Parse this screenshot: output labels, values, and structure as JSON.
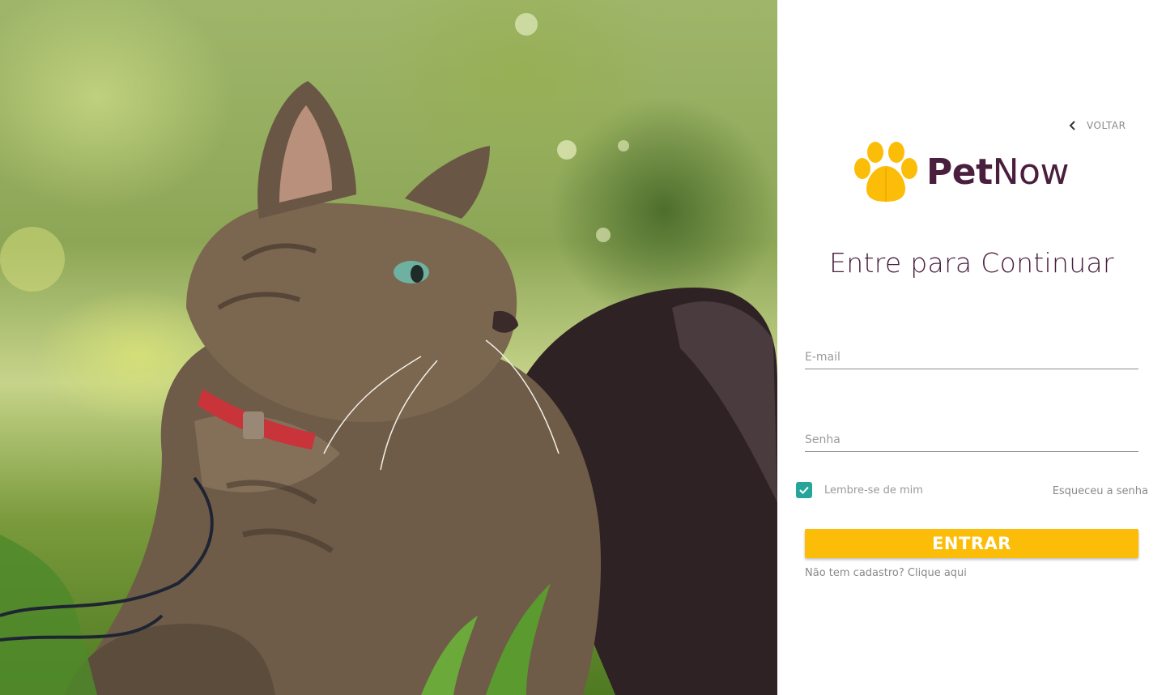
{
  "nav": {
    "back_label": "VOLTAR"
  },
  "brand": {
    "name_bold": "Pet",
    "name_regular": "Now",
    "accent_color": "#fbbd08",
    "text_color": "#4a1f3e"
  },
  "login": {
    "heading": "Entre para Continuar",
    "email_placeholder": "E-mail",
    "password_placeholder": "Senha",
    "remember_label": "Lembre-se de mim",
    "remember_checked": true,
    "forgot_label": "Esqueceu a senha",
    "submit_label": "ENTRAR",
    "signup_label": "Não tem cadastro? Clique aqui"
  },
  "icons": {
    "back": "chevron-left-icon",
    "logo": "paw-icon",
    "checkbox": "check-icon"
  },
  "colors": {
    "checkbox": "#26a69a",
    "button": "#fbbd08"
  }
}
